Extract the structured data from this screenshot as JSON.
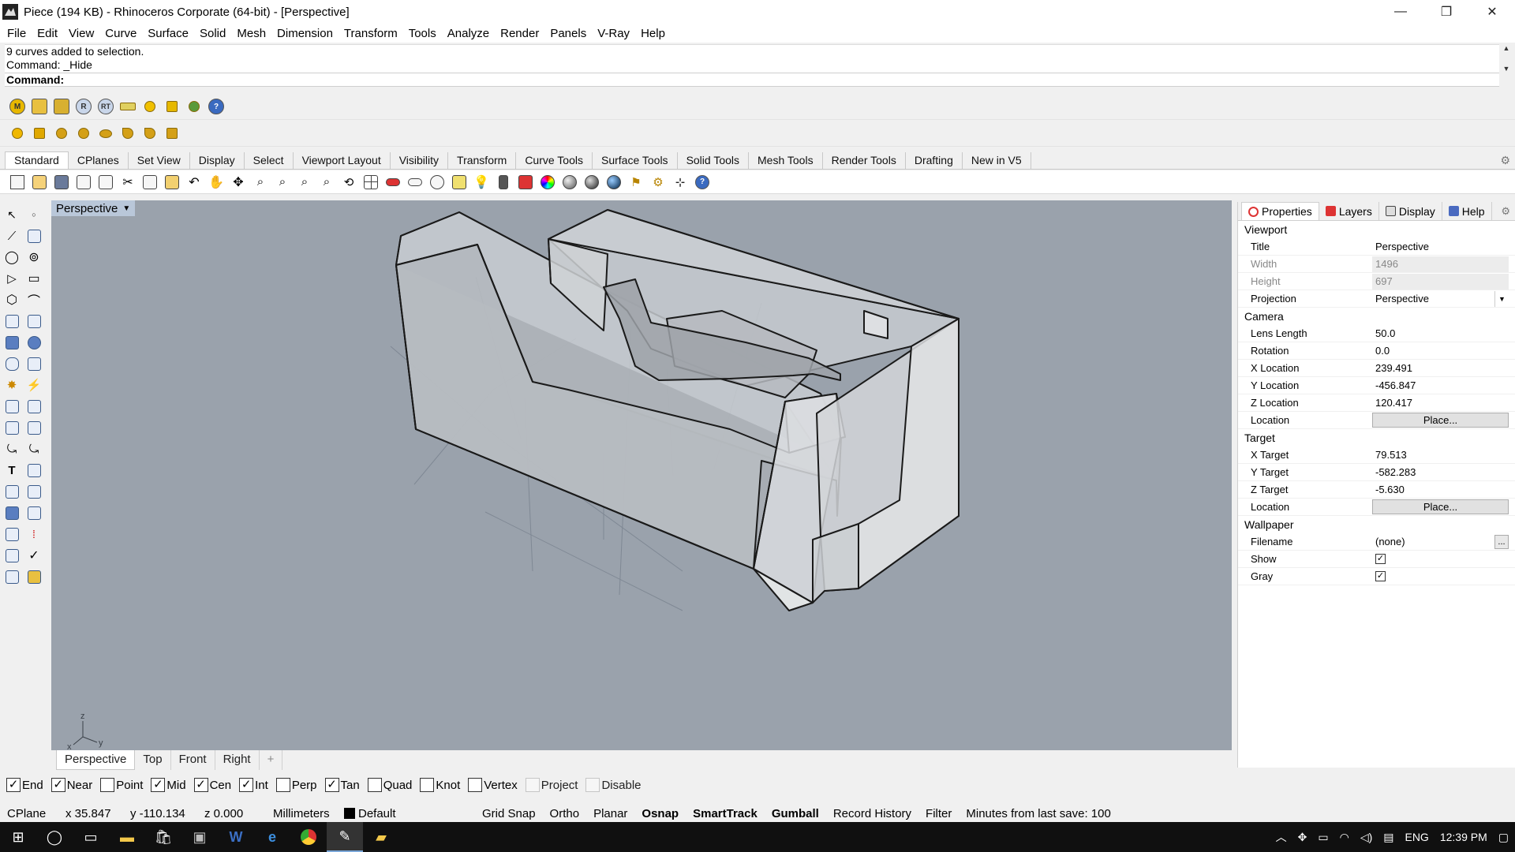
{
  "window": {
    "title": "Piece (194 KB) - Rhinoceros Corporate (64-bit) - [Perspective]",
    "min": "—",
    "restore": "❐",
    "close": "✕"
  },
  "menu": [
    "File",
    "Edit",
    "View",
    "Curve",
    "Surface",
    "Solid",
    "Mesh",
    "Dimension",
    "Transform",
    "Tools",
    "Analyze",
    "Render",
    "Panels",
    "V-Ray",
    "Help"
  ],
  "history": {
    "line1": "9 curves added to selection.",
    "line2": "Command: _Hide"
  },
  "command": {
    "label": "Command:"
  },
  "vray_row1": [
    "M",
    "🏷",
    "🏷",
    "R",
    "RT",
    "~",
    "SUN",
    "✦",
    "🌿",
    "?"
  ],
  "tabs": [
    "Standard",
    "CPlanes",
    "Set View",
    "Display",
    "Select",
    "Viewport Layout",
    "Visibility",
    "Transform",
    "Curve Tools",
    "Surface Tools",
    "Solid Tools",
    "Mesh Tools",
    "Render Tools",
    "Drafting",
    "New in V5"
  ],
  "viewport": {
    "title": "Perspective",
    "axes": {
      "z": "z",
      "x": "x",
      "y": "y"
    }
  },
  "viewport_tabs": [
    "Perspective",
    "Top",
    "Front",
    "Right",
    "+"
  ],
  "panel": {
    "tabs": [
      "Properties",
      "Layers",
      "Display",
      "Help"
    ],
    "viewport_section": "Viewport",
    "title_label": "Title",
    "title_value": "Perspective",
    "width_label": "Width",
    "width_value": "1496",
    "height_label": "Height",
    "height_value": "697",
    "projection_label": "Projection",
    "projection_value": "Perspective",
    "camera_section": "Camera",
    "lens_label": "Lens Length",
    "lens_value": "50.0",
    "rotation_label": "Rotation",
    "rotation_value": "0.0",
    "xloc_label": "X Location",
    "xloc_value": "239.491",
    "yloc_label": "Y Location",
    "yloc_value": "-456.847",
    "zloc_label": "Z Location",
    "zloc_value": "120.417",
    "loc_label": "Location",
    "place_label": "Place...",
    "target_section": "Target",
    "xt_label": "X Target",
    "xt_value": "79.513",
    "yt_label": "Y Target",
    "yt_value": "-582.283",
    "zt_label": "Z Target",
    "zt_value": "-5.630",
    "tloc_label": "Location",
    "wallpaper_section": "Wallpaper",
    "filename_label": "Filename",
    "filename_value": "(none)",
    "ellipsis": "...",
    "show_label": "Show",
    "gray_label": "Gray",
    "check": "✓"
  },
  "osnap": [
    {
      "label": "End",
      "checked": true
    },
    {
      "label": "Near",
      "checked": true
    },
    {
      "label": "Point",
      "checked": false
    },
    {
      "label": "Mid",
      "checked": true
    },
    {
      "label": "Cen",
      "checked": true
    },
    {
      "label": "Int",
      "checked": true
    },
    {
      "label": "Perp",
      "checked": false
    },
    {
      "label": "Tan",
      "checked": true
    },
    {
      "label": "Quad",
      "checked": false
    },
    {
      "label": "Knot",
      "checked": false
    },
    {
      "label": "Vertex",
      "checked": false
    },
    {
      "label": "Project",
      "checked": false,
      "disabled": true
    },
    {
      "label": "Disable",
      "checked": false,
      "disabled": true
    }
  ],
  "status": {
    "cplane": "CPlane",
    "x": "x 35.847",
    "y": "y -110.134",
    "z": "z 0.000",
    "units": "Millimeters",
    "layer": "Default",
    "grid_snap": "Grid Snap",
    "ortho": "Ortho",
    "planar": "Planar",
    "osnap": "Osnap",
    "smarttrack": "SmartTrack",
    "gumball": "Gumball",
    "record": "Record History",
    "filter": "Filter",
    "save": "Minutes from last save: 100"
  },
  "taskbar": {
    "lang": "ENG",
    "time": "12:39 PM"
  }
}
